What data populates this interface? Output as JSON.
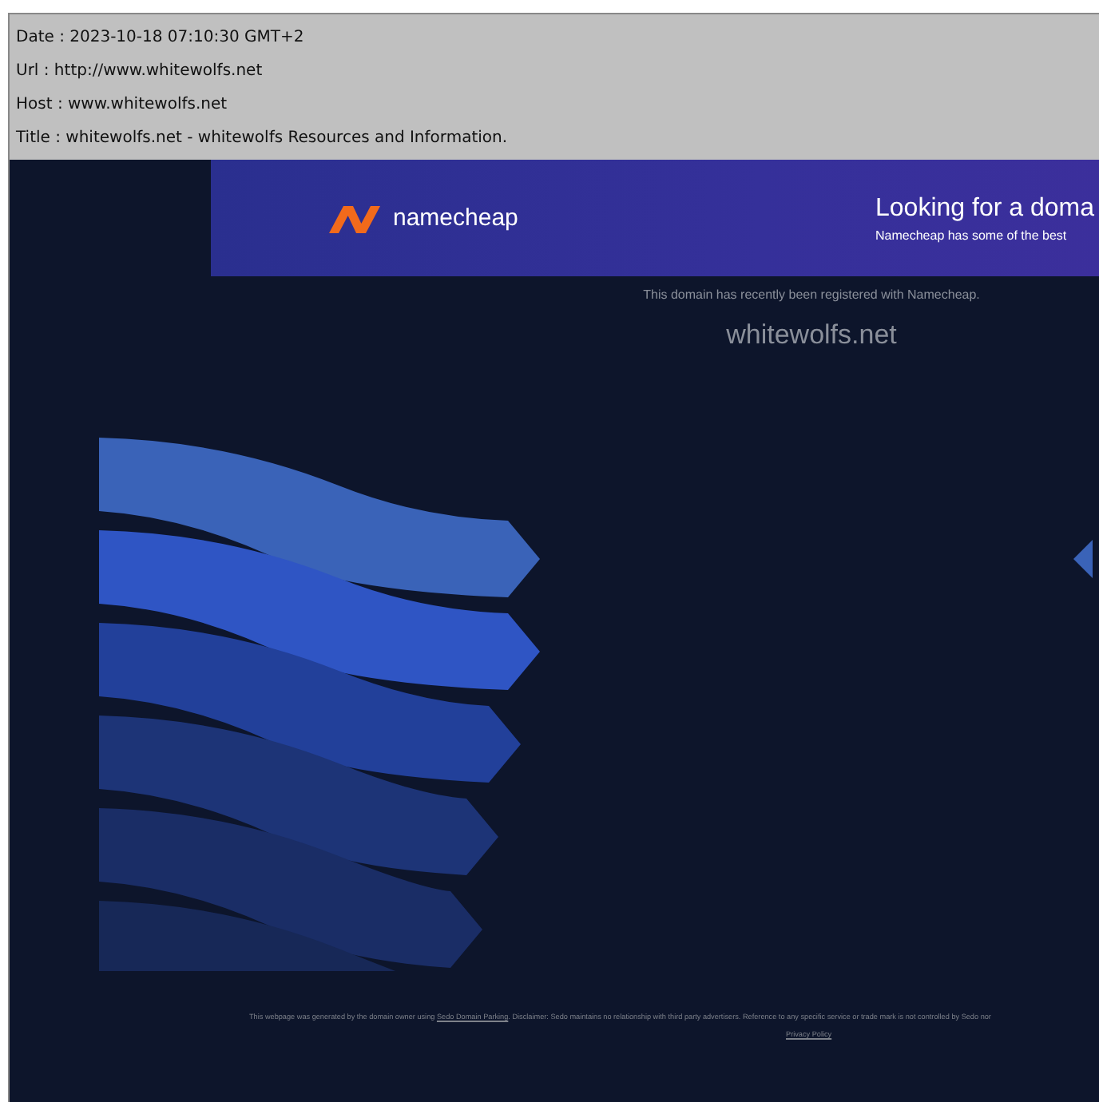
{
  "capture_info": [
    "Date : 2023-10-18 07:10:30 GMT+2",
    "Url : http://www.whitewolfs.net",
    "Host : www.whitewolfs.net",
    "Title : whitewolfs.net - whitewolfs Resources and Information."
  ],
  "banner": {
    "brand": "namecheap",
    "headline": "Looking for a doma",
    "subline": "Namecheap has some of the best"
  },
  "notice": "This domain has recently been registered with Namecheap.",
  "domain": "whitewolfs.net",
  "footer": {
    "before_link": "This webpage was generated by the domain owner using ",
    "link": "Sedo Domain Parking",
    "after_link": ". Disclaimer: Sedo maintains no relationship with third party advertisers. Reference to any specific service or trade mark is not controlled by Sedo nor",
    "privacy": "Privacy Policy"
  }
}
